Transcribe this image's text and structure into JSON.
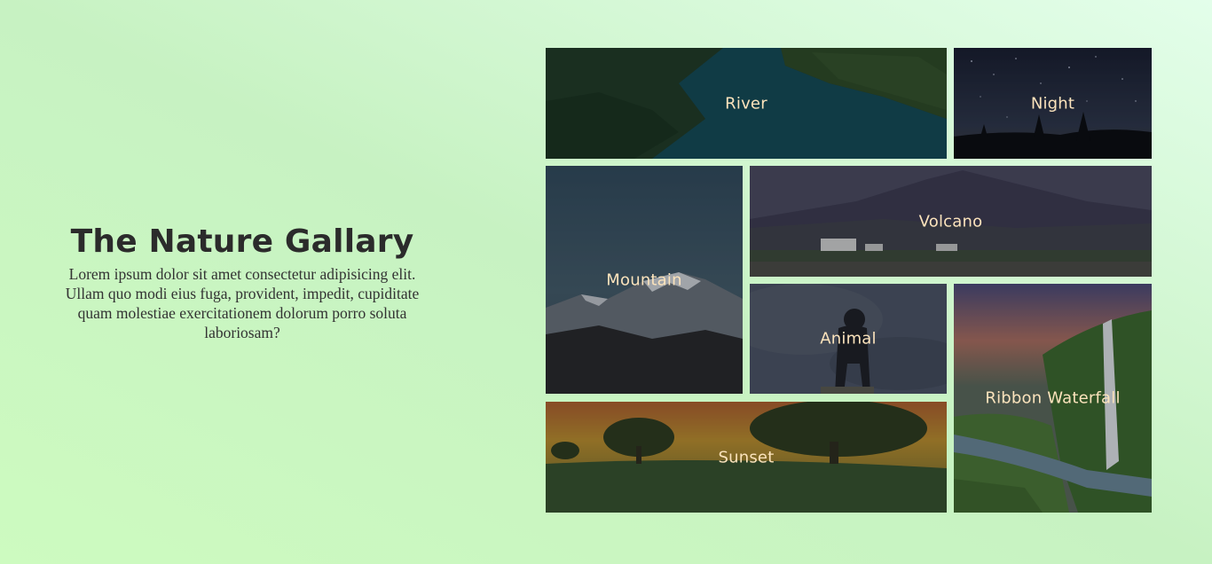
{
  "intro": {
    "title": "The Nature Gallary",
    "description": "Lorem ipsum dolor sit amet consectetur adipisicing elit. Ullam quo modi eius fuga, provident, impedit, cupiditate quam molestiae exercitationem dolorum porro soluta laboriosam?"
  },
  "gallery": {
    "river": "River",
    "night": "Night",
    "mountain": "Mountain",
    "volcano": "Volcano",
    "animal": "Animal",
    "waterfall": "Ribbon Waterfall",
    "sunset": "Sunset"
  },
  "colors": {
    "background": "#c9f4c0",
    "label": "#fbe3bc",
    "title": "#2b2b2b"
  }
}
